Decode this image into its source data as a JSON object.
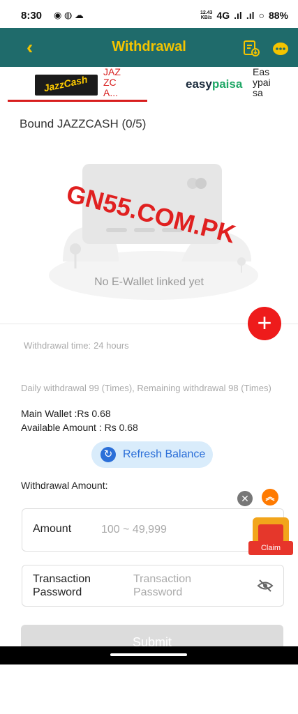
{
  "status": {
    "time": "8:30",
    "net_speed": "12.43\nKB/s",
    "network": "4G",
    "battery": "88%"
  },
  "header": {
    "back_icon": "chevron-left-icon",
    "title": "Withdrawal",
    "records_icon": "clipboard-download-icon",
    "support_icon": "chat-support-icon"
  },
  "tabs": [
    {
      "logo_text": "JazzCash",
      "label": "JAZZCA..."
    },
    {
      "logo_text_a": "easy",
      "logo_text_b": "paisa",
      "label": "Easypaisa"
    }
  ],
  "bound": {
    "title": "Bound JAZZCASH (0/5)",
    "empty": "No E-Wallet linked yet"
  },
  "watermark": "GN55.COM.PK",
  "info": {
    "withdrawal_time_label": "Withdrawal time:",
    "withdrawal_time_value": "24 hours",
    "daily": "Daily withdrawal 99 (Times), Remaining withdrawal 98 (Times)",
    "main_wallet": "Main Wallet :Rs 0.68",
    "available": "Available Amount : Rs 0.68"
  },
  "refresh_label": "Refresh Balance",
  "form": {
    "section_label": "Withdrawal Amount:",
    "amount_label": "Amount",
    "amount_placeholder": "100 ~ 49,999",
    "password_label": "Transaction Password",
    "password_placeholder": "Transaction Password",
    "submit_label": "Submit"
  },
  "gift": {
    "claim_label": "Claim"
  },
  "colors": {
    "appbar": "#1f6b6b",
    "accent_yellow": "#f4c400",
    "red": "#d81e1e",
    "blue": "#2b6fd8"
  }
}
